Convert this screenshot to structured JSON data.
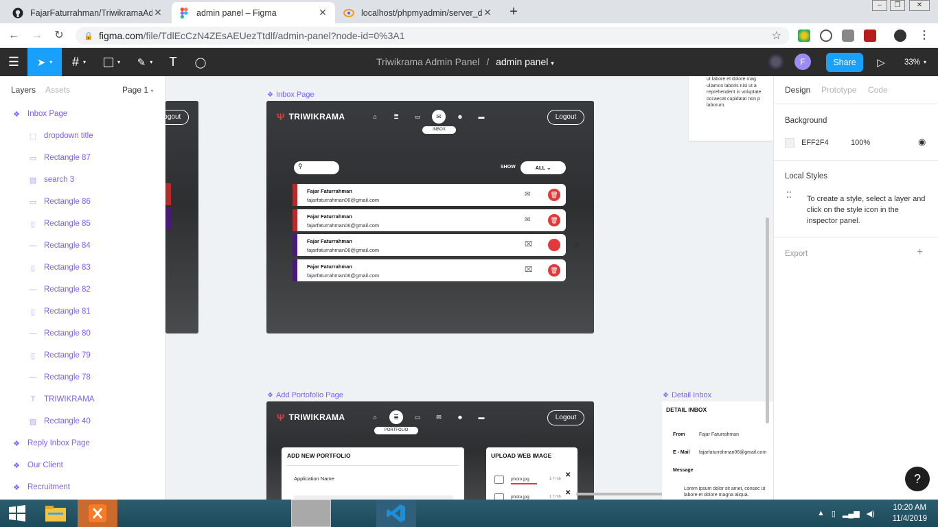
{
  "browser": {
    "tabs": [
      {
        "title": "FajarFaturrahman/TriwikramaAdm",
        "icon": "github-icon"
      },
      {
        "title": "admin panel – Figma",
        "icon": "figma-icon"
      },
      {
        "title": "localhost/phpmyadmin/server_d",
        "icon": "phpmyadmin-icon"
      }
    ],
    "url_host": "figma.com",
    "url_path": "/file/TdlEcCzN4ZEsAEUezTtdlf/admin-panel?node-id=0%3A1"
  },
  "figma": {
    "project": "Triwikrama Admin Panel",
    "separator": "/",
    "file": "admin panel",
    "share_label": "Share",
    "avatar_letter": "F",
    "zoom": "33%"
  },
  "left_panel": {
    "tab_layers": "Layers",
    "tab_assets": "Assets",
    "page": "Page 1",
    "layers": [
      {
        "name": "Inbox Page",
        "level": "top",
        "icon": "component"
      },
      {
        "name": "dropdown title",
        "level": "child",
        "icon": "frame-dashed"
      },
      {
        "name": "Rectangle 87",
        "level": "child",
        "icon": "rect-h"
      },
      {
        "name": "search 3",
        "level": "child",
        "icon": "image"
      },
      {
        "name": "Rectangle 86",
        "level": "child",
        "icon": "rect-h"
      },
      {
        "name": "Rectangle 85",
        "level": "child",
        "icon": "rect-v"
      },
      {
        "name": "Rectangle 84",
        "level": "child",
        "icon": "line"
      },
      {
        "name": "Rectangle 83",
        "level": "child",
        "icon": "rect-v"
      },
      {
        "name": "Rectangle 82",
        "level": "child",
        "icon": "line"
      },
      {
        "name": "Rectangle 81",
        "level": "child",
        "icon": "rect-v"
      },
      {
        "name": "Rectangle 80",
        "level": "child",
        "icon": "line"
      },
      {
        "name": "Rectangle 79",
        "level": "child",
        "icon": "rect-v"
      },
      {
        "name": "Rectangle 78",
        "level": "child",
        "icon": "line"
      },
      {
        "name": "TRIWIKRAMA",
        "level": "child",
        "icon": "text"
      },
      {
        "name": "Rectangle 40",
        "level": "child",
        "icon": "image"
      },
      {
        "name": "Reply Inbox Page",
        "level": "top",
        "icon": "component"
      },
      {
        "name": "Our Client",
        "level": "top",
        "icon": "component"
      },
      {
        "name": "Recruitment",
        "level": "top",
        "icon": "component"
      }
    ]
  },
  "canvas": {
    "left_frame_logout": "Logout",
    "inbox_frame": {
      "label": "Inbox Page",
      "brand": "TRIWIKRAMA",
      "active_nav": "INBOX",
      "logout": "Logout",
      "show_label": "SHOW",
      "filter": "ALL",
      "mails": [
        {
          "name": "Fajar Faturrahman",
          "email": "fajarfaturrahman06@gmail.com",
          "color": "#b52a2a"
        },
        {
          "name": "Fajar Faturrahman",
          "email": "fajarfaturrahman06@gmail.com",
          "color": "#b52a2a"
        },
        {
          "name": "Fajar Faturrahman",
          "email": "fajarfaturrahman06@gmail.com",
          "color": "#4a1a7a"
        },
        {
          "name": "Fajar Faturrahman",
          "email": "fajarfaturrahman06@gmail.com",
          "color": "#4a1a7a"
        }
      ]
    },
    "portfolio_frame": {
      "label": "Add Portofolio Page",
      "brand": "TRIWIKRAMA",
      "active_nav": "PORTFOLIO",
      "logout": "Logout",
      "card1_title": "ADD NEW PORTFOLIO",
      "card1_field": "Application Name",
      "card2_title": "UPLOAD WEB IMAGE",
      "files": [
        {
          "name": "photo.jpg",
          "size": "1.7 mb"
        },
        {
          "name": "photo.jpg",
          "size": "1.7 mb"
        }
      ]
    },
    "detail_frame": {
      "label": "Detail Inbox",
      "title": "DETAIL INBOX",
      "from_label": "From",
      "from_value": "Fajar Faturrahman",
      "email_label": "E - Mail",
      "email_value": "fajarfaturrahman06@gmail.com",
      "message_label": "Message",
      "message_text": "Lorem ipsum dolor sit amet, consec ut labore et dolore magna aliqua."
    },
    "top_right_text": "ut labore et dolore mag ullamco laboris nisi ut a reprehenderit in voluptate occaecat cupidatat non p laborum."
  },
  "right_panel": {
    "tab_design": "Design",
    "tab_prototype": "Prototype",
    "tab_code": "Code",
    "background_label": "Background",
    "bg_hex": "EFF2F4",
    "bg_opacity": "100%",
    "local_styles_label": "Local Styles",
    "local_styles_hint": "To create a style, select a layer and click on the style icon in the inspector panel.",
    "export_label": "Export",
    "help": "?"
  },
  "taskbar": {
    "time": "10:20 AM",
    "date": "11/4/2019"
  },
  "colors": {
    "figma_accent": "#18a0fb",
    "component_purple": "#7b61ff",
    "delete_red": "#e03a3a",
    "canvas_bg": "#eff2f4"
  }
}
